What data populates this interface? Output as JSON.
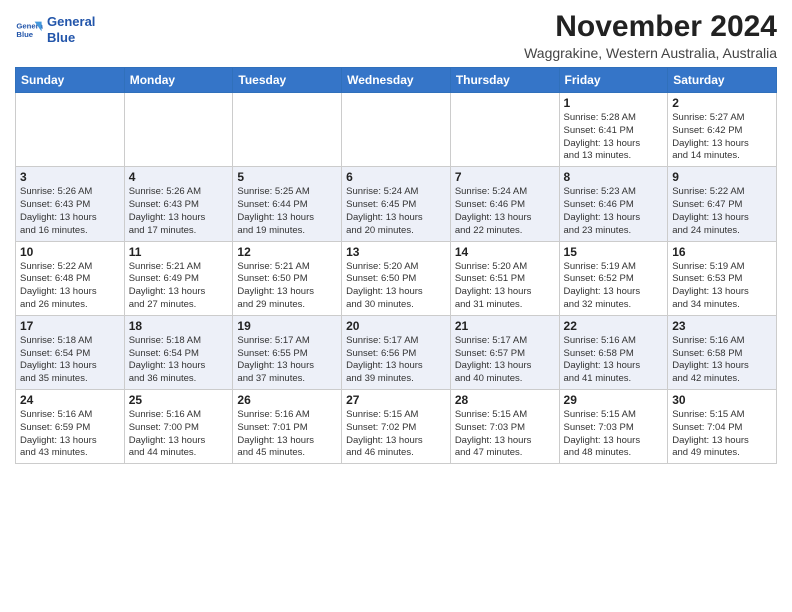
{
  "header": {
    "logo_line1": "General",
    "logo_line2": "Blue",
    "title": "November 2024",
    "subtitle": "Waggrakine, Western Australia, Australia"
  },
  "calendar": {
    "days_of_week": [
      "Sunday",
      "Monday",
      "Tuesday",
      "Wednesday",
      "Thursday",
      "Friday",
      "Saturday"
    ],
    "weeks": [
      [
        {
          "day": "",
          "info": ""
        },
        {
          "day": "",
          "info": ""
        },
        {
          "day": "",
          "info": ""
        },
        {
          "day": "",
          "info": ""
        },
        {
          "day": "",
          "info": ""
        },
        {
          "day": "1",
          "info": "Sunrise: 5:28 AM\nSunset: 6:41 PM\nDaylight: 13 hours\nand 13 minutes."
        },
        {
          "day": "2",
          "info": "Sunrise: 5:27 AM\nSunset: 6:42 PM\nDaylight: 13 hours\nand 14 minutes."
        }
      ],
      [
        {
          "day": "3",
          "info": "Sunrise: 5:26 AM\nSunset: 6:43 PM\nDaylight: 13 hours\nand 16 minutes."
        },
        {
          "day": "4",
          "info": "Sunrise: 5:26 AM\nSunset: 6:43 PM\nDaylight: 13 hours\nand 17 minutes."
        },
        {
          "day": "5",
          "info": "Sunrise: 5:25 AM\nSunset: 6:44 PM\nDaylight: 13 hours\nand 19 minutes."
        },
        {
          "day": "6",
          "info": "Sunrise: 5:24 AM\nSunset: 6:45 PM\nDaylight: 13 hours\nand 20 minutes."
        },
        {
          "day": "7",
          "info": "Sunrise: 5:24 AM\nSunset: 6:46 PM\nDaylight: 13 hours\nand 22 minutes."
        },
        {
          "day": "8",
          "info": "Sunrise: 5:23 AM\nSunset: 6:46 PM\nDaylight: 13 hours\nand 23 minutes."
        },
        {
          "day": "9",
          "info": "Sunrise: 5:22 AM\nSunset: 6:47 PM\nDaylight: 13 hours\nand 24 minutes."
        }
      ],
      [
        {
          "day": "10",
          "info": "Sunrise: 5:22 AM\nSunset: 6:48 PM\nDaylight: 13 hours\nand 26 minutes."
        },
        {
          "day": "11",
          "info": "Sunrise: 5:21 AM\nSunset: 6:49 PM\nDaylight: 13 hours\nand 27 minutes."
        },
        {
          "day": "12",
          "info": "Sunrise: 5:21 AM\nSunset: 6:50 PM\nDaylight: 13 hours\nand 29 minutes."
        },
        {
          "day": "13",
          "info": "Sunrise: 5:20 AM\nSunset: 6:50 PM\nDaylight: 13 hours\nand 30 minutes."
        },
        {
          "day": "14",
          "info": "Sunrise: 5:20 AM\nSunset: 6:51 PM\nDaylight: 13 hours\nand 31 minutes."
        },
        {
          "day": "15",
          "info": "Sunrise: 5:19 AM\nSunset: 6:52 PM\nDaylight: 13 hours\nand 32 minutes."
        },
        {
          "day": "16",
          "info": "Sunrise: 5:19 AM\nSunset: 6:53 PM\nDaylight: 13 hours\nand 34 minutes."
        }
      ],
      [
        {
          "day": "17",
          "info": "Sunrise: 5:18 AM\nSunset: 6:54 PM\nDaylight: 13 hours\nand 35 minutes."
        },
        {
          "day": "18",
          "info": "Sunrise: 5:18 AM\nSunset: 6:54 PM\nDaylight: 13 hours\nand 36 minutes."
        },
        {
          "day": "19",
          "info": "Sunrise: 5:17 AM\nSunset: 6:55 PM\nDaylight: 13 hours\nand 37 minutes."
        },
        {
          "day": "20",
          "info": "Sunrise: 5:17 AM\nSunset: 6:56 PM\nDaylight: 13 hours\nand 39 minutes."
        },
        {
          "day": "21",
          "info": "Sunrise: 5:17 AM\nSunset: 6:57 PM\nDaylight: 13 hours\nand 40 minutes."
        },
        {
          "day": "22",
          "info": "Sunrise: 5:16 AM\nSunset: 6:58 PM\nDaylight: 13 hours\nand 41 minutes."
        },
        {
          "day": "23",
          "info": "Sunrise: 5:16 AM\nSunset: 6:58 PM\nDaylight: 13 hours\nand 42 minutes."
        }
      ],
      [
        {
          "day": "24",
          "info": "Sunrise: 5:16 AM\nSunset: 6:59 PM\nDaylight: 13 hours\nand 43 minutes."
        },
        {
          "day": "25",
          "info": "Sunrise: 5:16 AM\nSunset: 7:00 PM\nDaylight: 13 hours\nand 44 minutes."
        },
        {
          "day": "26",
          "info": "Sunrise: 5:16 AM\nSunset: 7:01 PM\nDaylight: 13 hours\nand 45 minutes."
        },
        {
          "day": "27",
          "info": "Sunrise: 5:15 AM\nSunset: 7:02 PM\nDaylight: 13 hours\nand 46 minutes."
        },
        {
          "day": "28",
          "info": "Sunrise: 5:15 AM\nSunset: 7:03 PM\nDaylight: 13 hours\nand 47 minutes."
        },
        {
          "day": "29",
          "info": "Sunrise: 5:15 AM\nSunset: 7:03 PM\nDaylight: 13 hours\nand 48 minutes."
        },
        {
          "day": "30",
          "info": "Sunrise: 5:15 AM\nSunset: 7:04 PM\nDaylight: 13 hours\nand 49 minutes."
        }
      ]
    ]
  }
}
